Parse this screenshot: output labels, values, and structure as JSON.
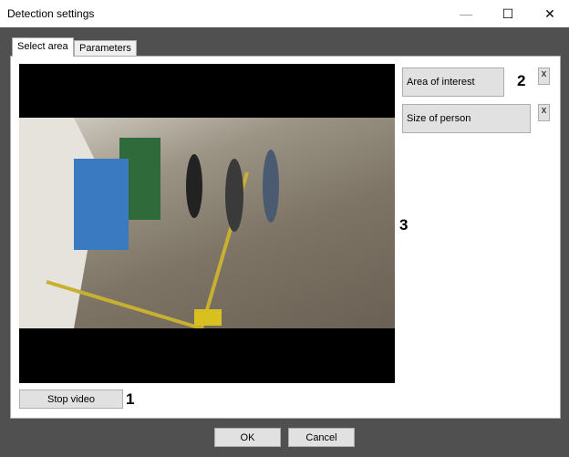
{
  "window": {
    "title": "Detection settings",
    "minimize": "—",
    "maximize": "☐",
    "close": "✕"
  },
  "tabs": [
    {
      "label": "Select area",
      "active": true
    },
    {
      "label": "Parameters",
      "active": false
    }
  ],
  "areas": [
    {
      "label": "Area of interest",
      "remove": "x"
    },
    {
      "label": "Size of person",
      "remove": "x"
    }
  ],
  "callouts": {
    "one": "1",
    "two": "2",
    "three": "3"
  },
  "video": {
    "stop_label": "Stop video"
  },
  "footer": {
    "ok": "OK",
    "cancel": "Cancel"
  }
}
